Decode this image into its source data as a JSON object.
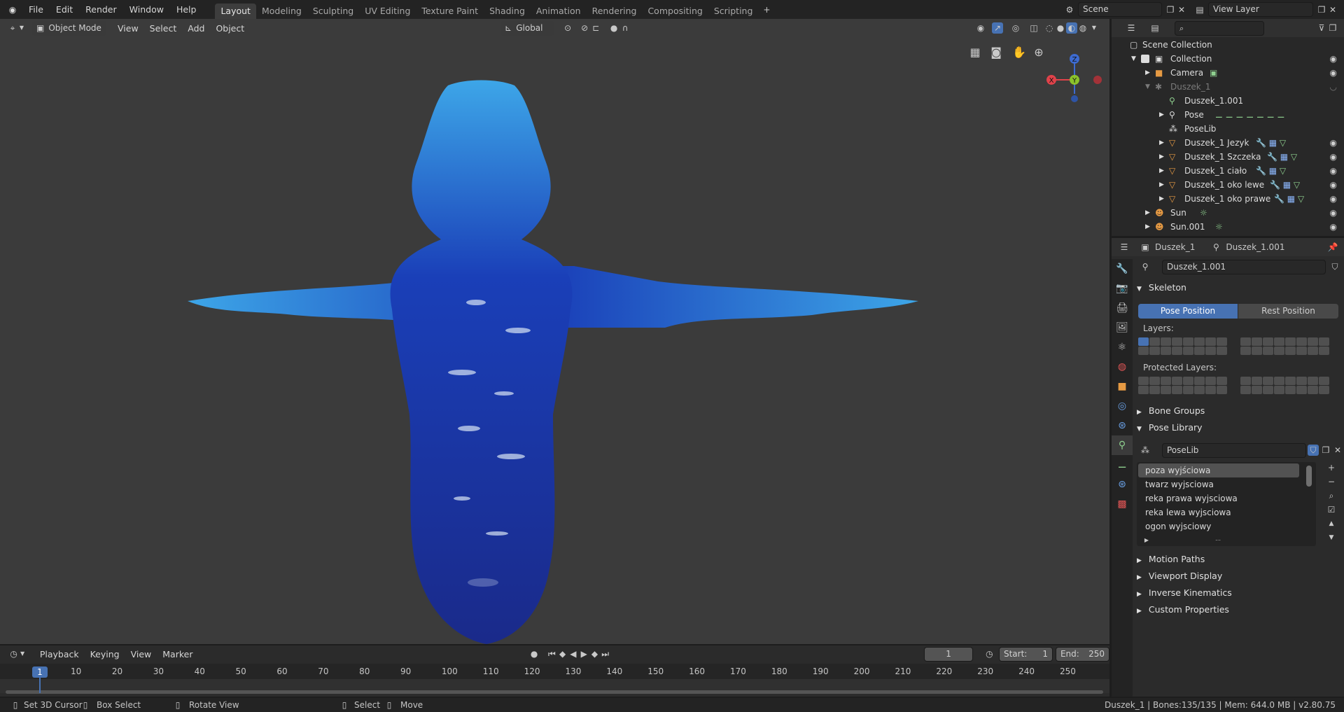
{
  "menus": [
    "File",
    "Edit",
    "Render",
    "Window",
    "Help"
  ],
  "workspaces": [
    "Layout",
    "Modeling",
    "Sculpting",
    "UV Editing",
    "Texture Paint",
    "Shading",
    "Animation",
    "Rendering",
    "Compositing",
    "Scripting"
  ],
  "scene": {
    "name": "Scene",
    "view_layer": "View Layer"
  },
  "viewport": {
    "mode": "Object Mode",
    "menus": [
      "View",
      "Select",
      "Add",
      "Object"
    ],
    "orientation": "Global",
    "gizmo": {
      "z": "Z",
      "x": "X",
      "y": "Y"
    }
  },
  "outliner": {
    "rows": [
      {
        "label": "Scene Collection"
      },
      {
        "label": "Collection"
      },
      {
        "label": "Camera"
      },
      {
        "label": "Duszek_1"
      },
      {
        "label": "Duszek_1.001"
      },
      {
        "label": "Pose"
      },
      {
        "label": "PoseLib"
      },
      {
        "label": "Duszek_1 Jezyk"
      },
      {
        "label": "Duszek_1 Szczeka"
      },
      {
        "label": "Duszek_1 ciało"
      },
      {
        "label": "Duszek_1 oko lewe"
      },
      {
        "label": "Duszek_1 oko prawe"
      },
      {
        "label": "Sun"
      },
      {
        "label": "Sun.001"
      }
    ]
  },
  "props": {
    "object": "Duszek_1",
    "data": "Duszek_1.001",
    "armature_name": "Duszek_1.001",
    "skeleton": "Skeleton",
    "pose_position": "Pose Position",
    "rest_position": "Rest Position",
    "layers": "Layers:",
    "protected_layers": "Protected Layers:",
    "bone_groups": "Bone Groups",
    "pose_library": "Pose Library",
    "poselib": "PoseLib",
    "poses": [
      "poza wyjściowa",
      "twarz wyjsciowa",
      "reka prawa wyjsciowa",
      "reka lewa wyjsciowa",
      "ogon wyjsciowy"
    ],
    "motion_paths": "Motion Paths",
    "viewport_display": "Viewport Display",
    "inverse_kinematics": "Inverse Kinematics",
    "custom_properties": "Custom Properties"
  },
  "timeline": {
    "menus": [
      "Playback",
      "Keying",
      "View",
      "Marker"
    ],
    "current_frame": "1",
    "start_label": "Start:",
    "start": "1",
    "end_label": "End:",
    "end": "250",
    "ticks": [
      "1",
      "10",
      "20",
      "30",
      "40",
      "50",
      "60",
      "70",
      "80",
      "90",
      "100",
      "110",
      "120",
      "130",
      "140",
      "150",
      "160",
      "170",
      "180",
      "190",
      "200",
      "210",
      "220",
      "230",
      "240",
      "250"
    ]
  },
  "status": {
    "set_cursor": "Set 3D Cursor",
    "box_select": "Box Select",
    "rotate_view": "Rotate View",
    "select": "Select",
    "move": "Move",
    "info": "Duszek_1 | Bones:135/135 | Mem: 644.0 MB | v2.80.75"
  },
  "colors": {
    "accent": "#4772b3",
    "ghost_dark": "#1a2a8a",
    "ghost_light": "#3da6e8"
  }
}
